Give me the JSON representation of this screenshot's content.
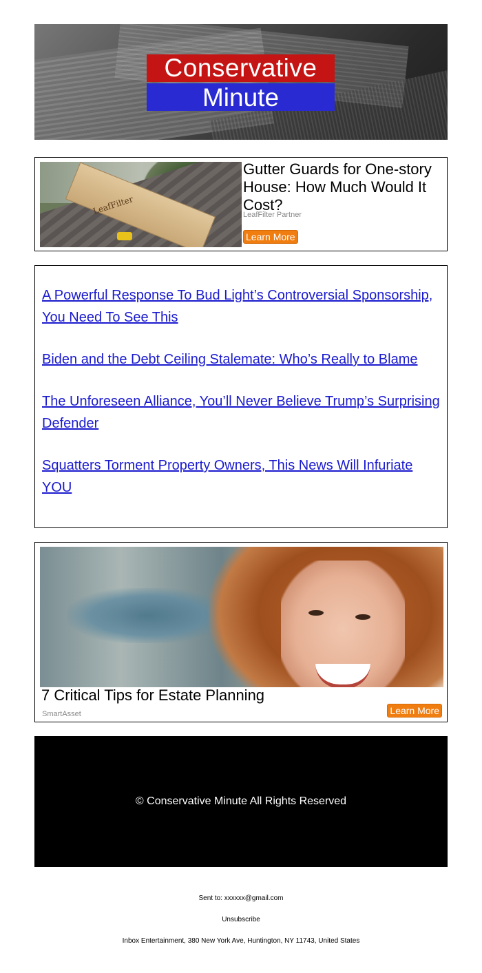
{
  "header": {
    "logo_line1": "Conservative",
    "logo_line2": "Minute"
  },
  "ad1": {
    "title": "Gutter Guards for One-story House: How Much Would It Cost?",
    "source": "LeafFilter Partner",
    "button": "Learn More",
    "image_label": "LeafFilter"
  },
  "articles": [
    {
      "title": "A Powerful Response To Bud Light’s Controversial Sponsorship, You Need To See This"
    },
    {
      "title": "Biden and the Debt Ceiling Stalemate: Who’s Really to Blame"
    },
    {
      "title": "The Unforeseen Alliance, You’ll Never Believe Trump’s Surprising Defender"
    },
    {
      "title": "Squatters Torment Property Owners, This News Will Infuriate YOU"
    }
  ],
  "ad2": {
    "title": "7 Critical Tips for Estate Planning",
    "source": "SmartAsset",
    "button": "Learn More"
  },
  "footer": {
    "copyright": "© Conservative Minute All Rights Reserved"
  },
  "meta": {
    "sent_to": "Sent to: xxxxxx@gmail.com",
    "unsubscribe": "Unsubscribe",
    "address": "Inbox Entertainment, 380 New York Ave, Huntington, NY 11743, United States"
  },
  "colors": {
    "logo_red": "#c41414",
    "logo_blue": "#2a2ad2",
    "link_blue": "#1a1acf",
    "button_orange": "#f07d10"
  }
}
